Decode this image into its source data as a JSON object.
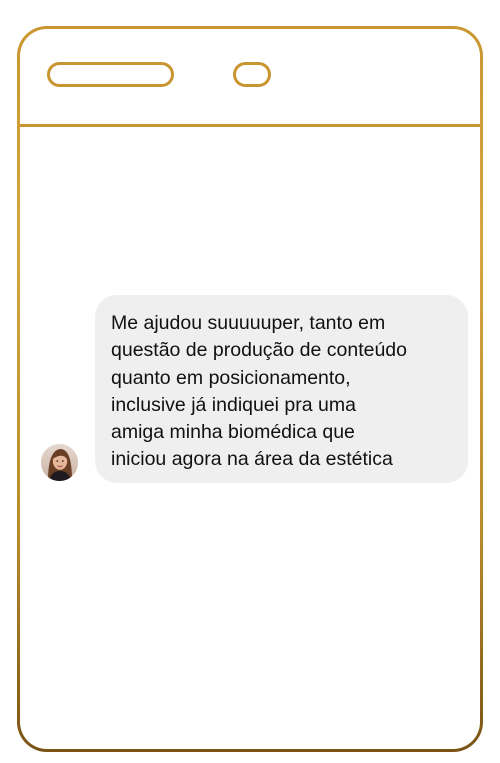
{
  "chat": {
    "message": {
      "text": "Me ajudou suuuuuper, tanto em\nquestão de produção de conteúdo\nquanto em posicionamento,\ninclusive já indiquei pra uma\namiga minha biomédica que\niniciou agora na área da estética"
    },
    "avatar": {
      "icon": "user-avatar-photo"
    }
  },
  "colors": {
    "frame_gold": "#c99530",
    "bubble_background": "#efefef",
    "text": "#111111"
  }
}
